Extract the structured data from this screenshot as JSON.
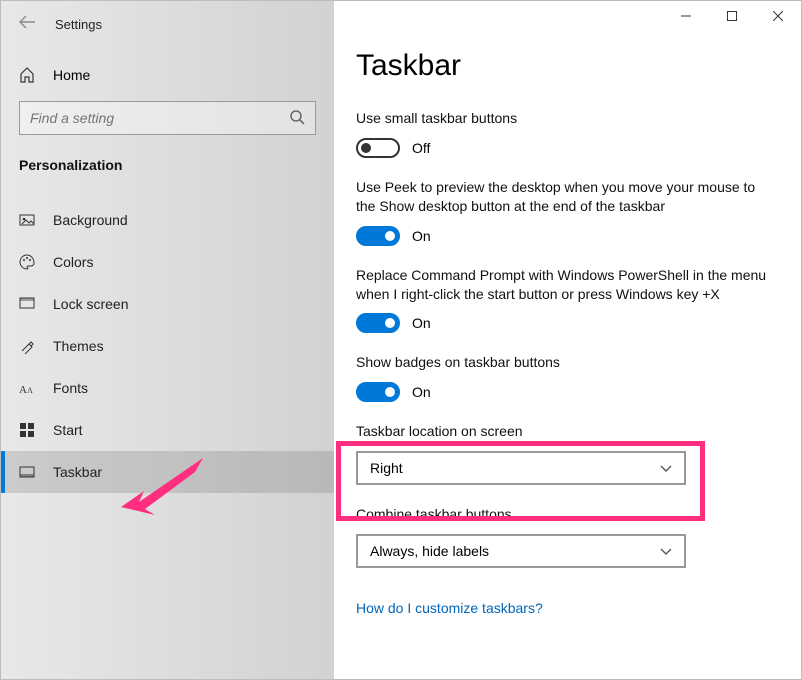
{
  "window": {
    "title": "Settings",
    "controls": {
      "minimize": "—",
      "maximize": "▢",
      "close": "✕"
    }
  },
  "sidebar": {
    "home_label": "Home",
    "search_placeholder": "Find a setting",
    "category": "Personalization",
    "items": [
      {
        "label": "Background",
        "icon": "image-icon"
      },
      {
        "label": "Colors",
        "icon": "palette-icon"
      },
      {
        "label": "Lock screen",
        "icon": "lockscreen-icon"
      },
      {
        "label": "Themes",
        "icon": "themes-icon"
      },
      {
        "label": "Fonts",
        "icon": "fonts-icon"
      },
      {
        "label": "Start",
        "icon": "start-icon"
      },
      {
        "label": "Taskbar",
        "icon": "taskbar-icon",
        "selected": true
      }
    ]
  },
  "main": {
    "heading": "Taskbar",
    "settings": {
      "small_buttons": {
        "label": "Use small taskbar buttons",
        "state_label": "Off",
        "on": false
      },
      "peek": {
        "label": "Use Peek to preview the desktop when you move your mouse to the Show desktop button at the end of the taskbar",
        "state_label": "On",
        "on": true
      },
      "powershell": {
        "label": "Replace Command Prompt with Windows PowerShell in the menu when I right-click the start button or press Windows key +X",
        "state_label": "On",
        "on": true
      },
      "badges": {
        "label": "Show badges on taskbar buttons",
        "state_label": "On",
        "on": true
      },
      "location": {
        "label": "Taskbar location on screen",
        "value": "Right"
      },
      "combine": {
        "label": "Combine taskbar buttons",
        "value": "Always, hide labels"
      }
    },
    "help_link": "How do I customize taskbars?"
  },
  "annotation": {
    "arrow_color": "#ff2e7e"
  }
}
